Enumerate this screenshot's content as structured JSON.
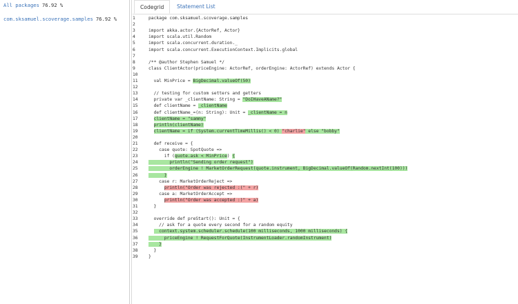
{
  "sidebar": {
    "all_packages": {
      "label": "All packages",
      "percent": "76.92 %"
    },
    "packages": [
      {
        "label": "com.sksamuel.scoverage.samples",
        "percent": "76.92 %"
      }
    ]
  },
  "tabs": [
    {
      "label": "Codegrid",
      "active": true
    },
    {
      "label": "Statement List",
      "active": false
    }
  ],
  "colors": {
    "covered": "#a8e6a0",
    "uncovered": "#f3a3a3",
    "link": "#3b73b9"
  },
  "code": [
    {
      "n": "1",
      "seg": [
        [
          "package com.sksamuel.scoverage.samples",
          ""
        ]
      ]
    },
    {
      "n": "2",
      "seg": []
    },
    {
      "n": "3",
      "seg": [
        [
          "import akka.actor.{ActorRef, Actor}",
          ""
        ]
      ]
    },
    {
      "n": "4",
      "seg": [
        [
          "import scala.util.Random",
          ""
        ]
      ]
    },
    {
      "n": "5",
      "seg": [
        [
          "import scala.concurrent.duration._",
          ""
        ]
      ]
    },
    {
      "n": "6",
      "seg": [
        [
          "import scala.concurrent.ExecutionContext.Implicits.global",
          ""
        ]
      ]
    },
    {
      "n": "7",
      "seg": []
    },
    {
      "n": "8",
      "seg": [
        [
          "/** @author Stephen Samuel */",
          ""
        ]
      ]
    },
    {
      "n": "9",
      "seg": [
        [
          "class ClientActor(priceEngine: ActorRef, orderEngine: ActorRef) extends Actor {",
          ""
        ]
      ]
    },
    {
      "n": "10",
      "seg": []
    },
    {
      "n": "11",
      "seg": [
        [
          "  val MinPrice = ",
          ""
        ],
        [
          "BigDecimal.valueOf(50)",
          "g"
        ]
      ]
    },
    {
      "n": "12",
      "seg": []
    },
    {
      "n": "13",
      "seg": [
        [
          "  // testing for custom setters and getters",
          ""
        ]
      ]
    },
    {
      "n": "14",
      "seg": [
        [
          "  private var _clientName: String = ",
          ""
        ],
        [
          "\"DoIHaveAName?\"",
          "g"
        ]
      ]
    },
    {
      "n": "15",
      "seg": [
        [
          "  def clientName = ",
          ""
        ],
        [
          "_clientName",
          "g"
        ]
      ]
    },
    {
      "n": "16",
      "seg": [
        [
          "  def clientName_=(n: String): Unit = ",
          ""
        ],
        [
          "_clientName = n",
          "g"
        ]
      ]
    },
    {
      "n": "17",
      "seg": [
        [
          "  ",
          ""
        ],
        [
          "clientName = \"sammy\"",
          "g"
        ]
      ]
    },
    {
      "n": "18",
      "seg": [
        [
          "  ",
          ""
        ],
        [
          "println(clientName)",
          "g"
        ]
      ]
    },
    {
      "n": "19",
      "seg": [
        [
          "  ",
          ""
        ],
        [
          "clientName = if (System.currentTimeMillis() < 0) ",
          "g"
        ],
        [
          "\"charlie\"",
          "r"
        ],
        [
          " else \"bobby\"",
          "g"
        ]
      ]
    },
    {
      "n": "20",
      "seg": []
    },
    {
      "n": "21",
      "seg": [
        [
          "  def receive = {",
          ""
        ]
      ]
    },
    {
      "n": "22",
      "seg": [
        [
          "    case quote: SpotQuote =>",
          ""
        ]
      ]
    },
    {
      "n": "23",
      "seg": [
        [
          "      if (",
          ""
        ],
        [
          "quote.ask < MinPrice",
          "g"
        ],
        [
          ") ",
          ""
        ],
        [
          "{",
          "g"
        ]
      ]
    },
    {
      "n": "24",
      "seg": [
        [
          "",
          ""
        ],
        [
          "        println(\"Sending order request\")",
          "g"
        ]
      ]
    },
    {
      "n": "25",
      "seg": [
        [
          "",
          ""
        ],
        [
          "        orderEngine ! MarketOrderRequest(quote.instrument, BigDecimal.valueOf(Random.nextInt(100)))",
          "g"
        ]
      ]
    },
    {
      "n": "26",
      "seg": [
        [
          "",
          ""
        ],
        [
          "      }",
          "g"
        ]
      ]
    },
    {
      "n": "27",
      "seg": [
        [
          "    case r: MarketOrderReject =>",
          ""
        ]
      ]
    },
    {
      "n": "28",
      "seg": [
        [
          "      ",
          ""
        ],
        [
          "println(\"Order was rejected :(\" + r)",
          "r"
        ]
      ]
    },
    {
      "n": "29",
      "seg": [
        [
          "    case a: MarketOrderAccept =>",
          ""
        ]
      ]
    },
    {
      "n": "30",
      "seg": [
        [
          "      ",
          ""
        ],
        [
          "println(\"Order was accepted :)\" + a)",
          "r"
        ]
      ]
    },
    {
      "n": "31",
      "seg": [
        [
          "  }",
          ""
        ]
      ]
    },
    {
      "n": "32",
      "seg": []
    },
    {
      "n": "33",
      "seg": [
        [
          "  override def preStart(): Unit = {",
          ""
        ]
      ]
    },
    {
      "n": "34",
      "seg": [
        [
          "    // ask for a quote every second for a random equity",
          ""
        ]
      ]
    },
    {
      "n": "35",
      "seg": [
        [
          "  ",
          ""
        ],
        [
          "  context.system.scheduler.schedule(100 milliseconds, 1000 milliseconds) {",
          "g"
        ]
      ]
    },
    {
      "n": "36",
      "seg": [
        [
          "",
          ""
        ],
        [
          "      priceEngine ! RequestForQuote(InstrumentLoader.randomInstrument)",
          "g"
        ]
      ]
    },
    {
      "n": "37",
      "seg": [
        [
          "",
          ""
        ],
        [
          "    }",
          "g"
        ]
      ]
    },
    {
      "n": "38",
      "seg": [
        [
          "  }",
          ""
        ]
      ]
    },
    {
      "n": "39",
      "seg": [
        [
          "}",
          ""
        ]
      ]
    }
  ]
}
